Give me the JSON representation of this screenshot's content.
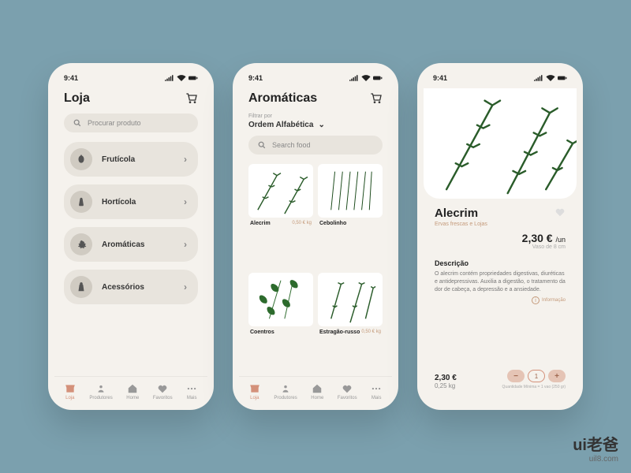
{
  "statusbar": {
    "time": "9:41"
  },
  "screen1": {
    "title": "Loja",
    "search_placeholder": "Procurar produto",
    "categories": [
      {
        "label": "Frutícola"
      },
      {
        "label": "Hortícola"
      },
      {
        "label": "Aromáticas"
      },
      {
        "label": "Acessórios"
      }
    ]
  },
  "screen2": {
    "title": "Aromáticas",
    "filter_label": "Filtrar por",
    "filter_value": "Ordem Alfabética",
    "search_placeholder": "Search food",
    "products": [
      {
        "name": "Alecrim",
        "price": "0,50 € kg"
      },
      {
        "name": "Cebolinho",
        "price": ""
      },
      {
        "name": "Coentros",
        "price": ""
      },
      {
        "name": "Estragão-russo",
        "price": "0,50 € kg"
      }
    ]
  },
  "screen3": {
    "title": "Alecrim",
    "subtitle": "Ervas frescas e Lojas",
    "price": "2,30 €",
    "unit": "/un",
    "pot": "Vaso de 8 cm",
    "desc_h": "Descrição",
    "desc": "O alecrim contém propriedades digestivas, diuréticas e antidepressivas. Auxilia a digestão, o tratamento da dor de cabeça, a depressão e a ansiedade.",
    "info_label": "Informação",
    "total": "2,30 €",
    "weight": "0,25 kg",
    "qty": "1",
    "qty_note": "Quantidade Mínima = 1 vao (250 gr)"
  },
  "tabs": [
    {
      "label": "Loja"
    },
    {
      "label": "Produtores"
    },
    {
      "label": "Home"
    },
    {
      "label": "Favoritos"
    },
    {
      "label": "Mais"
    }
  ],
  "watermark": {
    "cn": "ui老爸",
    "url": "uil8.com"
  }
}
